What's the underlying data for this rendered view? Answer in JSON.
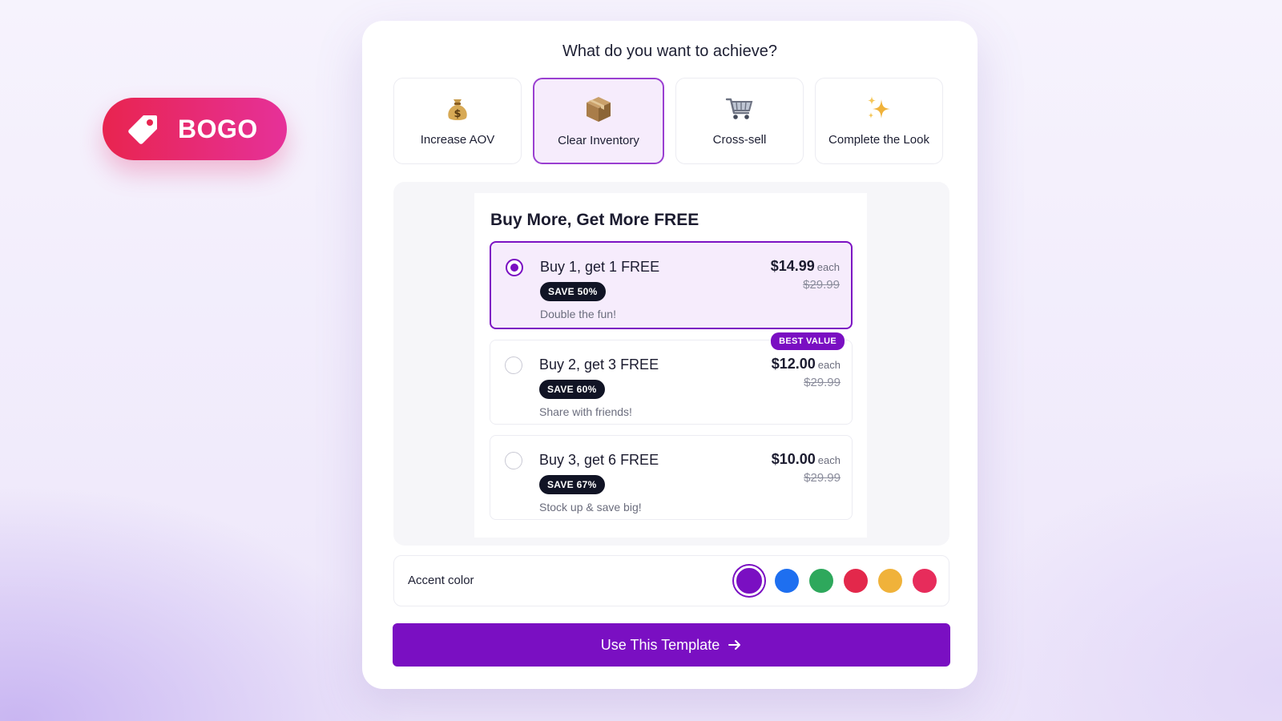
{
  "badge": {
    "label": "BOGO",
    "icon": "price-tag-icon"
  },
  "title": "What do you want to achieve?",
  "goals": [
    {
      "label": "Increase AOV",
      "icon": "money-bag-icon"
    },
    {
      "label": "Clear Inventory",
      "icon": "package-box-icon",
      "selected": true
    },
    {
      "label": "Cross-sell",
      "icon": "shopping-cart-icon"
    },
    {
      "label": "Complete the Look",
      "icon": "sparkles-icon"
    }
  ],
  "preview": {
    "title": "Buy More, Get More FREE",
    "offers": [
      {
        "title": "Buy 1, get 1 FREE",
        "save": "SAVE 50%",
        "subtitle": "Double the fun!",
        "price": "$14.99",
        "unit": "each",
        "old_price": "$29.99",
        "selected": true
      },
      {
        "title": "Buy 2, get 3 FREE",
        "save": "SAVE 60%",
        "subtitle": "Share with friends!",
        "price": "$12.00",
        "unit": "each",
        "old_price": "$29.99",
        "badge": "BEST VALUE"
      },
      {
        "title": "Buy 3, get 6 FREE",
        "save": "SAVE 67%",
        "subtitle": "Stock up & save big!",
        "price": "$10.00",
        "unit": "each",
        "old_price": "$29.99"
      }
    ]
  },
  "accent": {
    "label": "Accent color",
    "swatches": [
      {
        "name": "purple",
        "color": "#7a0fc2",
        "selected": true
      },
      {
        "name": "blue",
        "color": "#1e6ff0"
      },
      {
        "name": "green",
        "color": "#2ea85c"
      },
      {
        "name": "red",
        "color": "#e3284b"
      },
      {
        "name": "yellow",
        "color": "#f0b23a"
      },
      {
        "name": "pink",
        "color": "#e72c5b"
      }
    ]
  },
  "cta": {
    "label": "Use This Template",
    "icon": "arrow-right-icon"
  },
  "colors": {
    "accent": "#7a0fc2",
    "badge_gradient_start": "#e8244f",
    "badge_gradient_end": "#e63199"
  }
}
